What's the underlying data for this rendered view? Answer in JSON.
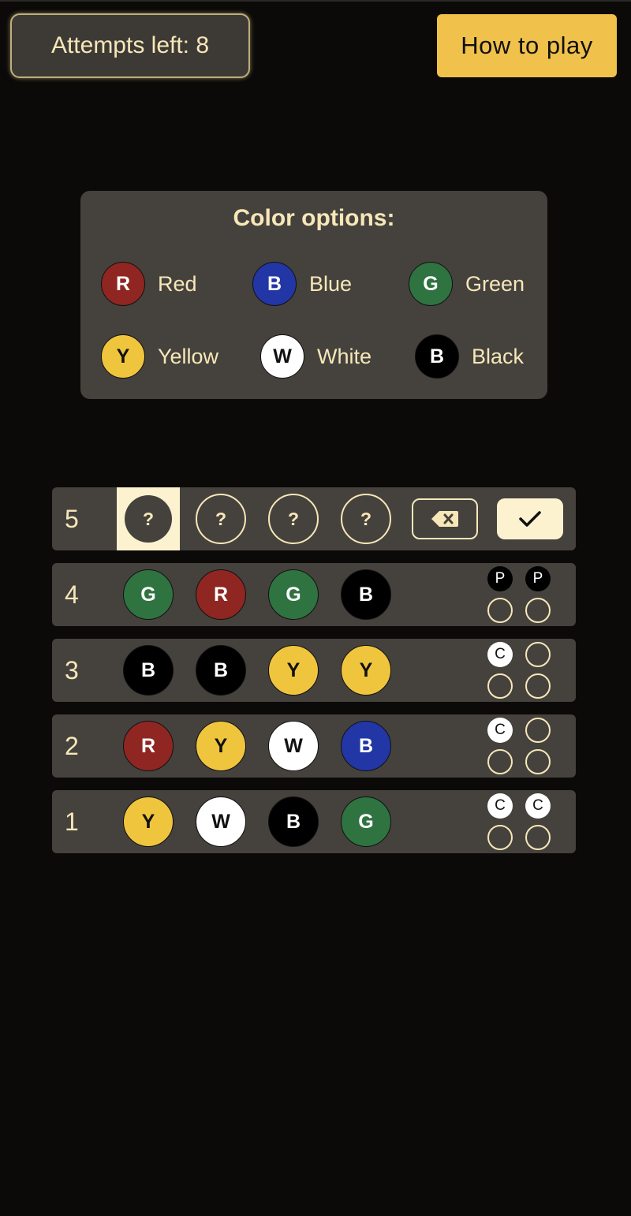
{
  "header": {
    "attempts_label": "Attempts left: 8",
    "how_to_play_label": "How to play"
  },
  "color_options": {
    "title": "Color options:",
    "items": [
      {
        "letter": "R",
        "name": "Red",
        "color": "#8f2622"
      },
      {
        "letter": "B",
        "name": "Blue",
        "color": "#2236a6"
      },
      {
        "letter": "G",
        "name": "Green",
        "color": "#2f7340"
      },
      {
        "letter": "Y",
        "name": "Yellow",
        "color": "#f0c53e"
      },
      {
        "letter": "W",
        "name": "White",
        "color": "#ffffff"
      },
      {
        "letter": "B",
        "name": "Black",
        "color": "#000000"
      }
    ]
  },
  "current_row": {
    "number": "5",
    "slots": [
      "?",
      "?",
      "?",
      "?"
    ],
    "delete_icon": "backspace-icon",
    "submit_icon": "check-icon"
  },
  "history": [
    {
      "number": "4",
      "pegs": [
        {
          "letter": "G",
          "color": "green"
        },
        {
          "letter": "R",
          "color": "red"
        },
        {
          "letter": "G",
          "color": "green"
        },
        {
          "letter": "B",
          "color": "black"
        }
      ],
      "feedback": [
        "P",
        "P",
        "",
        ""
      ]
    },
    {
      "number": "3",
      "pegs": [
        {
          "letter": "B",
          "color": "black"
        },
        {
          "letter": "B",
          "color": "black"
        },
        {
          "letter": "Y",
          "color": "yellow"
        },
        {
          "letter": "Y",
          "color": "yellow"
        }
      ],
      "feedback": [
        "C",
        "",
        "",
        ""
      ]
    },
    {
      "number": "2",
      "pegs": [
        {
          "letter": "R",
          "color": "red"
        },
        {
          "letter": "Y",
          "color": "yellow"
        },
        {
          "letter": "W",
          "color": "white"
        },
        {
          "letter": "B",
          "color": "blue"
        }
      ],
      "feedback": [
        "C",
        "",
        "",
        ""
      ]
    },
    {
      "number": "1",
      "pegs": [
        {
          "letter": "Y",
          "color": "yellow"
        },
        {
          "letter": "W",
          "color": "white"
        },
        {
          "letter": "B",
          "color": "black"
        },
        {
          "letter": "G",
          "color": "green"
        }
      ],
      "feedback": [
        "C",
        "C",
        "",
        ""
      ]
    }
  ]
}
